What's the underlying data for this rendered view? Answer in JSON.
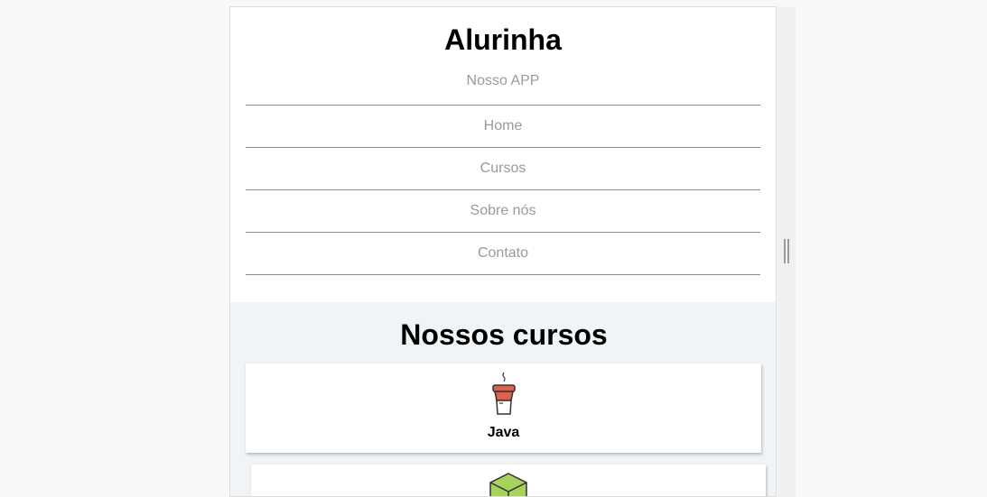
{
  "header": {
    "title": "Alurinha"
  },
  "nav": {
    "items": [
      {
        "label": "Nosso APP"
      },
      {
        "label": "Home"
      },
      {
        "label": "Cursos"
      },
      {
        "label": "Sobre nós"
      },
      {
        "label": "Contato"
      }
    ]
  },
  "courses": {
    "title": "Nossos cursos",
    "items": [
      {
        "name": "Java",
        "icon": "coffee-cup-icon"
      },
      {
        "name": "",
        "icon": "cube-icon"
      }
    ]
  },
  "colors": {
    "nav_text": "#9a9a9a",
    "courses_bg": "#f1f4f6",
    "java_red": "#e0604e",
    "cube_green": "#a7d35a"
  }
}
